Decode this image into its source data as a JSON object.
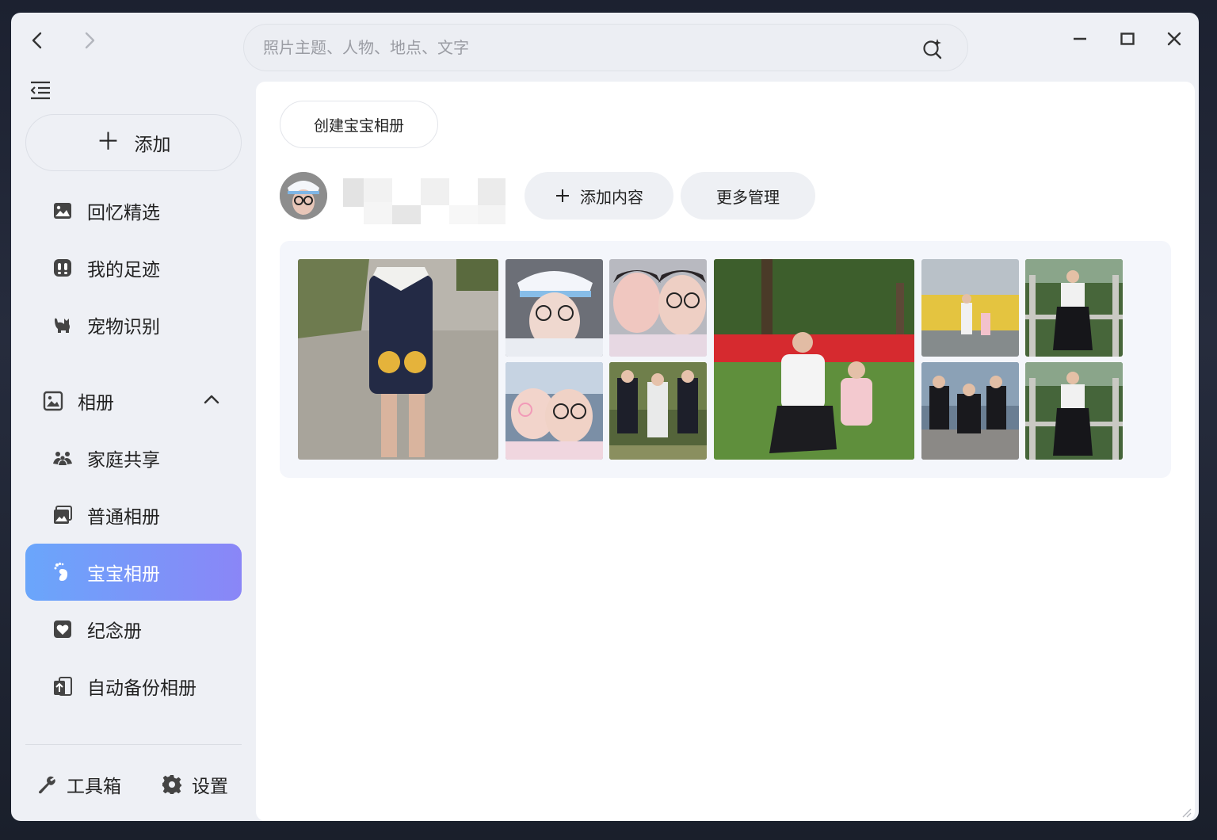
{
  "search": {
    "placeholder": "照片主题、人物、地点、文字"
  },
  "sidebar": {
    "add_label": "添加",
    "items": [
      {
        "label": "回忆精选",
        "icon": "image-icon"
      },
      {
        "label": "我的足迹",
        "icon": "footprint-icon"
      },
      {
        "label": "宠物识别",
        "icon": "pet-icon"
      }
    ],
    "section": {
      "label": "相册",
      "icon": "album-icon"
    },
    "albums": [
      {
        "label": "家庭共享",
        "icon": "family-icon"
      },
      {
        "label": "普通相册",
        "icon": "photo-album-icon"
      },
      {
        "label": "宝宝相册",
        "icon": "baby-foot-icon",
        "active": true
      },
      {
        "label": "纪念册",
        "icon": "heart-icon"
      },
      {
        "label": "自动备份相册",
        "icon": "backup-icon"
      }
    ],
    "footer": {
      "tools_label": "工具箱",
      "settings_label": "设置"
    }
  },
  "content": {
    "create_label": "创建宝宝相册",
    "add_content_label": "添加内容",
    "more_manage_label": "更多管理"
  },
  "colors": {
    "active_gradient_start": "#6aa6fb",
    "active_gradient_end": "#8a86f7",
    "window_bg": "#eef0f5",
    "content_bg": "#ffffff"
  }
}
